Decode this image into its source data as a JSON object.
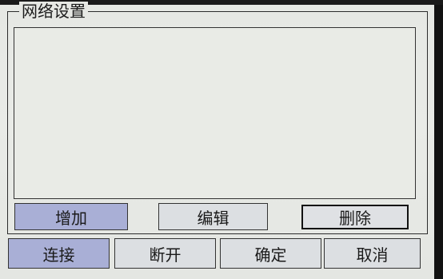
{
  "window": {
    "title": "网络设置"
  },
  "actions": {
    "add_label": "增加",
    "edit_label": "编辑",
    "delete_label": "删除"
  },
  "footer": {
    "connect_label": "连接",
    "disconnect_label": "断开",
    "ok_label": "确定",
    "cancel_label": "取消"
  },
  "colors": {
    "screen_bg": "#e6e8e4",
    "active_button": "#a9afd6",
    "plain_button": "#dcdfe2",
    "border": "#2c2c2c"
  }
}
